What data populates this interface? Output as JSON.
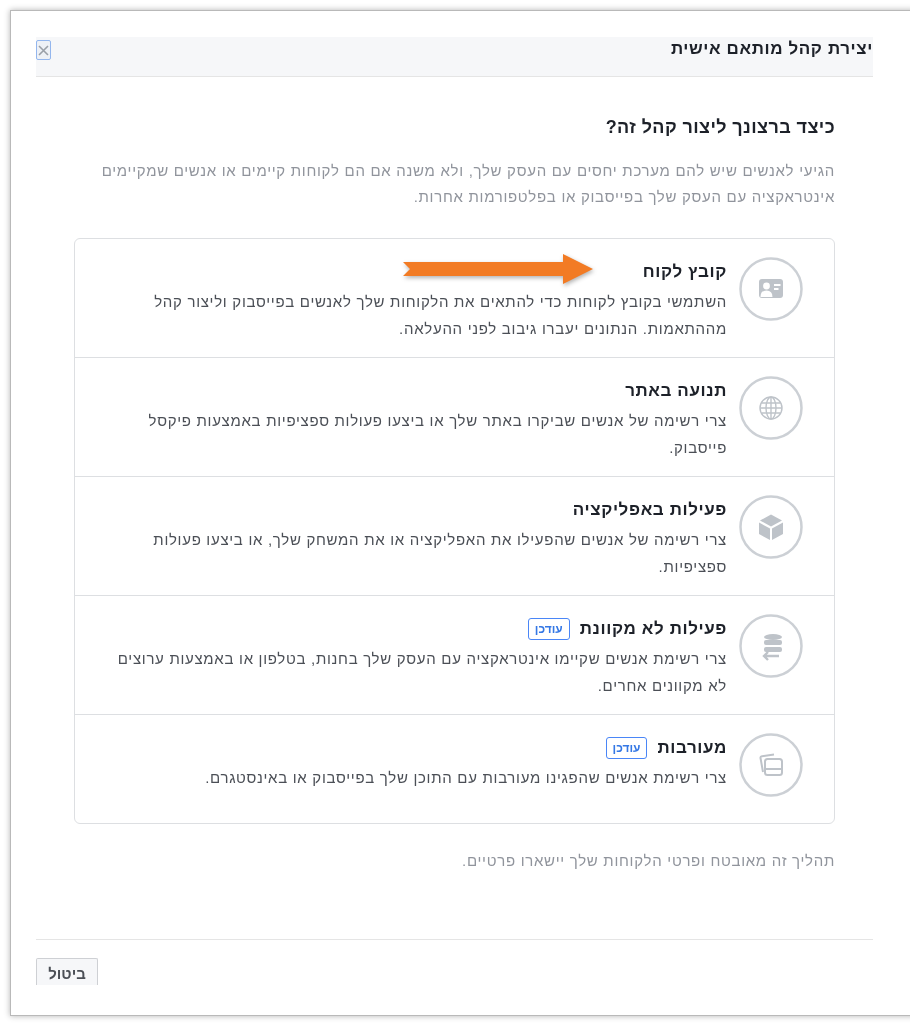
{
  "dialog": {
    "title": "יצירת קהל מותאם אישית"
  },
  "question": {
    "heading": "כיצד ברצונך ליצור קהל זה?",
    "description": "הגיעי לאנשים שיש להם מערכת יחסים עם העסק שלך, ולא משנה אם הם לקוחות קיימים או אנשים שמקיימים אינטראקציה עם העסק שלך בפייסבוק או בפלטפורמות אחרות."
  },
  "options": [
    {
      "kind": "customer_file",
      "title": "קובץ לקוח",
      "description": "השתמשי בקובץ לקוחות כדי להתאים את הלקוחות שלך לאנשים בפייסבוק וליצור קהל מההתאמות. הנתונים יעברו גיבוב לפני ההעלאה.",
      "pointed": true
    },
    {
      "kind": "website",
      "title": "תנועה באתר",
      "description": "צרי רשימה של אנשים שביקרו באתר שלך או ביצעו פעולות ספציפיות באמצעות פיקסל פייסבוק.",
      "pointed": false
    },
    {
      "kind": "app",
      "title": "פעילות באפליקציה",
      "description": "צרי רשימה של אנשים שהפעילו את האפליקציה או את המשחק שלך, או ביצעו פעולות ספציפיות.",
      "pointed": false
    },
    {
      "kind": "offline",
      "title": "פעילות לא מקוונת",
      "badge": "עודכן",
      "description": "צרי רשימת אנשים שקיימו אינטראקציה עם העסק שלך בחנות, בטלפון או באמצעות ערוצים לא מקוונים אחרים.",
      "pointed": false
    },
    {
      "kind": "engagement",
      "title": "מעורבות",
      "badge": "עודכן",
      "description": "צרי רשימת אנשים שהפגינו מעורבות עם התוכן שלך בפייסבוק או באינסטגרם.",
      "pointed": false
    }
  ],
  "privacy_note": "תהליך זה מאובטח ופרטי הלקוחות שלך יישארו פרטיים.",
  "buttons": [
    {
      "label": "ביטול"
    }
  ]
}
